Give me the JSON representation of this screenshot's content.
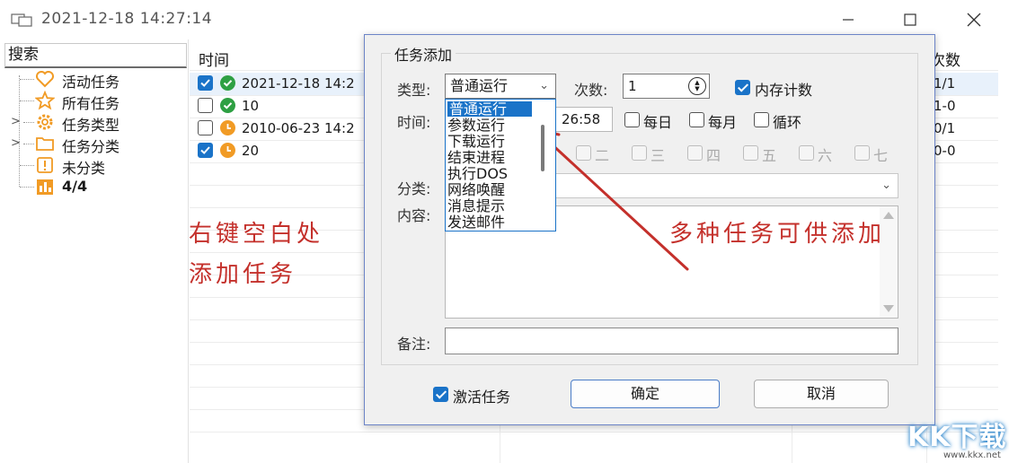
{
  "window": {
    "title": "2021-12-18 14:27:14"
  },
  "tree": {
    "search_label": "搜索",
    "items": [
      {
        "label": "活动任务",
        "icon": "heart-icon"
      },
      {
        "label": "所有任务",
        "icon": "star-icon"
      },
      {
        "label": "任务类型",
        "icon": "gear-icon"
      },
      {
        "label": "任务分类",
        "icon": "folder-icon"
      },
      {
        "label": "未分类",
        "icon": "exclamation-icon"
      },
      {
        "label": "4/4",
        "icon": "chart-icon"
      }
    ]
  },
  "grid": {
    "col_time": "时间",
    "col_count": "次数",
    "rows": [
      {
        "checked": true,
        "status": "ok",
        "text": "2021-12-18 14:2",
        "count": "1/1"
      },
      {
        "checked": false,
        "status": "ok",
        "text": "10",
        "count": "1-0"
      },
      {
        "checked": false,
        "status": "clock",
        "text": "2010-06-23 14:2",
        "count": "0/1"
      },
      {
        "checked": true,
        "status": "clock",
        "text": "20",
        "count": "0-0"
      }
    ]
  },
  "annotations": {
    "left_line1": "右键空白处",
    "left_line2": "添加任务",
    "right": "多种任务可供添加"
  },
  "dialog": {
    "group_title": "任务添加",
    "type_label": "类型:",
    "type_value": "普通运行",
    "count_label": "次数:",
    "count_value": "1",
    "mem_count_label": "内存计数",
    "time_label": "时间:",
    "time_value": "26:58",
    "daily_label": "每日",
    "monthly_label": "每月",
    "loop_label": "循环",
    "weekdays": [
      "二",
      "三",
      "四",
      "五",
      "六",
      "七"
    ],
    "category_label": "分类:",
    "content_label": "内容:",
    "remark_label": "备注:",
    "activate_label": "激活任务",
    "ok_button": "确定",
    "cancel_button": "取消"
  },
  "dropdown": {
    "items": [
      "普通运行",
      "参数运行",
      "下载运行",
      "结束进程",
      "执行DOS",
      "网络唤醒",
      "消息提示",
      "发送邮件"
    ]
  },
  "watermark": {
    "text": "KK下载",
    "url": "www.kkx.net"
  },
  "colors": {
    "accent": "#1a73c8",
    "annotation": "#c4302b",
    "ok_status": "#2ea043",
    "clock_status": "#f19b25"
  }
}
